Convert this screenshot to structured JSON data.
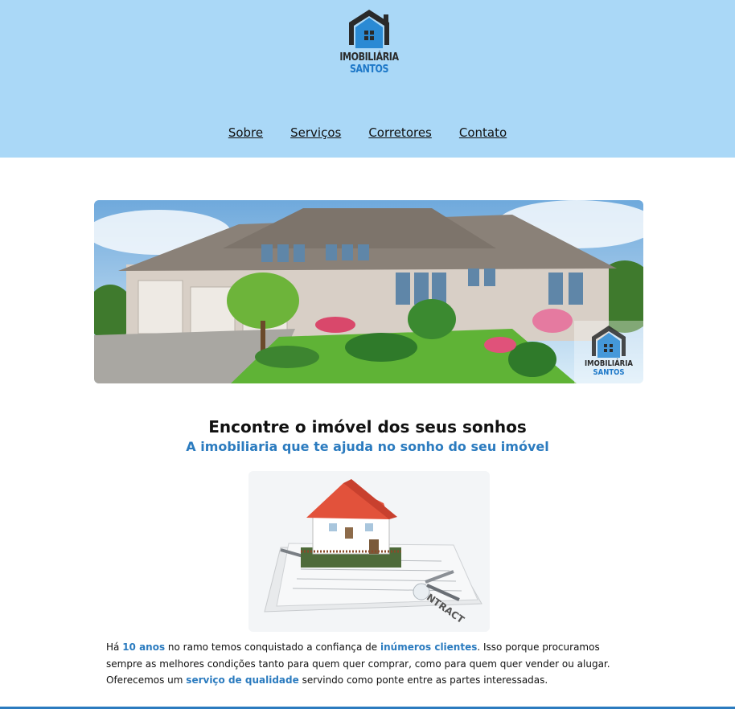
{
  "brand": {
    "line1": "IMOBILIÁRIA",
    "line2": "SANTOS",
    "colors": {
      "dark": "#2a2a2a",
      "blue": "#1e78c8"
    }
  },
  "nav": {
    "items": [
      {
        "label": "Sobre"
      },
      {
        "label": "Serviços"
      },
      {
        "label": "Corretores"
      },
      {
        "label": "Contato"
      }
    ]
  },
  "hero": {
    "watermark_line1": "IMOBILIÁRIA",
    "watermark_line2": "SANTOS"
  },
  "main": {
    "title": "Encontre o imóvel dos seus sonhos",
    "subtitle": "A imobiliaria que te ajuda no sonho do seu imóvel",
    "photo_label": "CONTRACT",
    "paragraph": {
      "p1": "Há ",
      "h1": "10 anos",
      "p2": " no ramo temos conquistado a confiança de ",
      "h2": "inúmeros clientes",
      "p3": ". Isso porque procuramos sempre as melhores condições tanto para quem quer comprar, como para quem quer vender ou alugar. Oferecemos um ",
      "h3": "serviço de qualidade",
      "p4": " servindo como ponte entre as partes interessadas."
    }
  },
  "theme": {
    "header_bg": "#aad8f7",
    "accent": "#2b7bbf"
  }
}
